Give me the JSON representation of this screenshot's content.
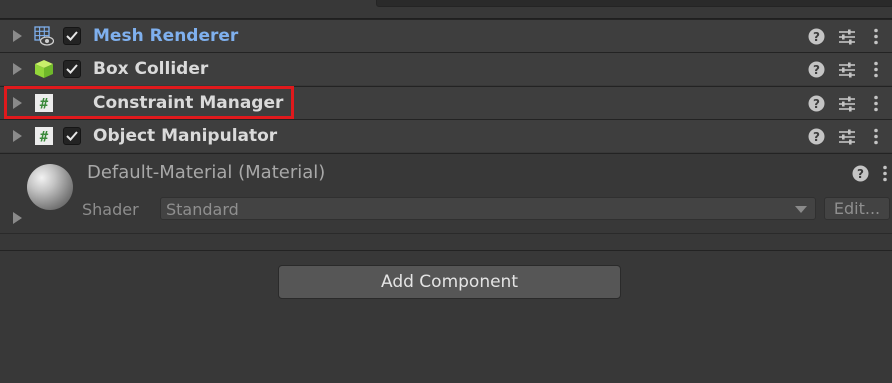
{
  "components": [
    {
      "label": "Mesh Renderer",
      "icon": "mesh-renderer-icon",
      "checked": true,
      "label_color": "#7fb0ee"
    },
    {
      "label": "Box Collider",
      "icon": "box-collider-icon",
      "checked": true,
      "label_color": "#dadada"
    },
    {
      "label": "Constraint Manager",
      "icon": "script-icon",
      "checked": false,
      "label_color": "#dadada"
    },
    {
      "label": "Object Manipulator",
      "icon": "script-icon",
      "checked": true,
      "label_color": "#dadada"
    }
  ],
  "highlight_color": "#e0191c",
  "material": {
    "title": "Default-Material (Material)",
    "shader_label": "Shader",
    "shader_value": "Standard",
    "edit_label": "Edit..."
  },
  "add_component_label": "Add Component"
}
